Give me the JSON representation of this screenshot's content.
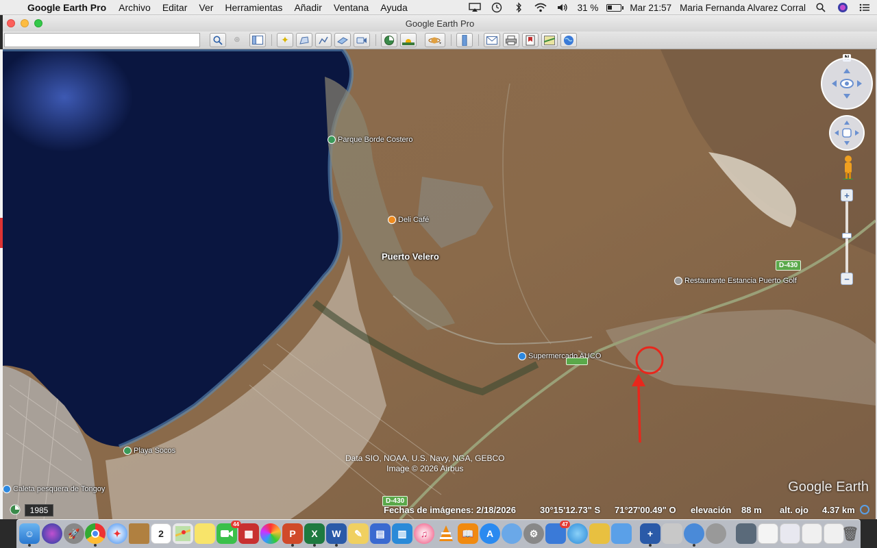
{
  "menubar": {
    "app_name": "Google Earth Pro",
    "items": [
      "Archivo",
      "Editar",
      "Ver",
      "Herramientas",
      "Añadir",
      "Ventana",
      "Ayuda"
    ],
    "battery": "31 %",
    "clock": "Mar 21:57",
    "user": "Maria Fernanda Alvarez Corral"
  },
  "window": {
    "title": "Google Earth Pro",
    "search_value": ""
  },
  "map": {
    "places": {
      "parque": "Parque Borde Costero",
      "deli": "Deli Café",
      "town": "Puerto Velero",
      "restaurante": "Restaurante Estancia Puerto Golf",
      "super": "Supermercado AUCO",
      "playa": "Playa Socos",
      "caleta": "Caleta pesquera de Tongoy"
    },
    "roads": {
      "d430_upper": "D-430",
      "d430_lower": "D-430"
    },
    "attribution_line1": "Data SIO, NOAA, U.S. Navy, NGA, GEBCO",
    "attribution_line2": "Image © 2026 Airbus",
    "logo": "Google Earth",
    "compass_north": "N"
  },
  "status": {
    "year": "1985",
    "imagery_date": "Fechas de imágenes: 2/18/2026",
    "lat": "30°15'12.73\" S",
    "lon": "71°27'00.49\" O",
    "elev_label": "elevación",
    "elev_value": "88 m",
    "eye_label": "alt. ojo",
    "eye_value": "4.37 km"
  },
  "dock": {
    "calendar_day": "2",
    "facetime_badge": "44",
    "appstore_badge": "47",
    "excel_letter": "X",
    "word_letter": "W",
    "ppt_letter": "P"
  },
  "colors": {
    "ocean": "#0a1a3d",
    "land": "#8a6a4c",
    "annotation": "#e8271c"
  }
}
